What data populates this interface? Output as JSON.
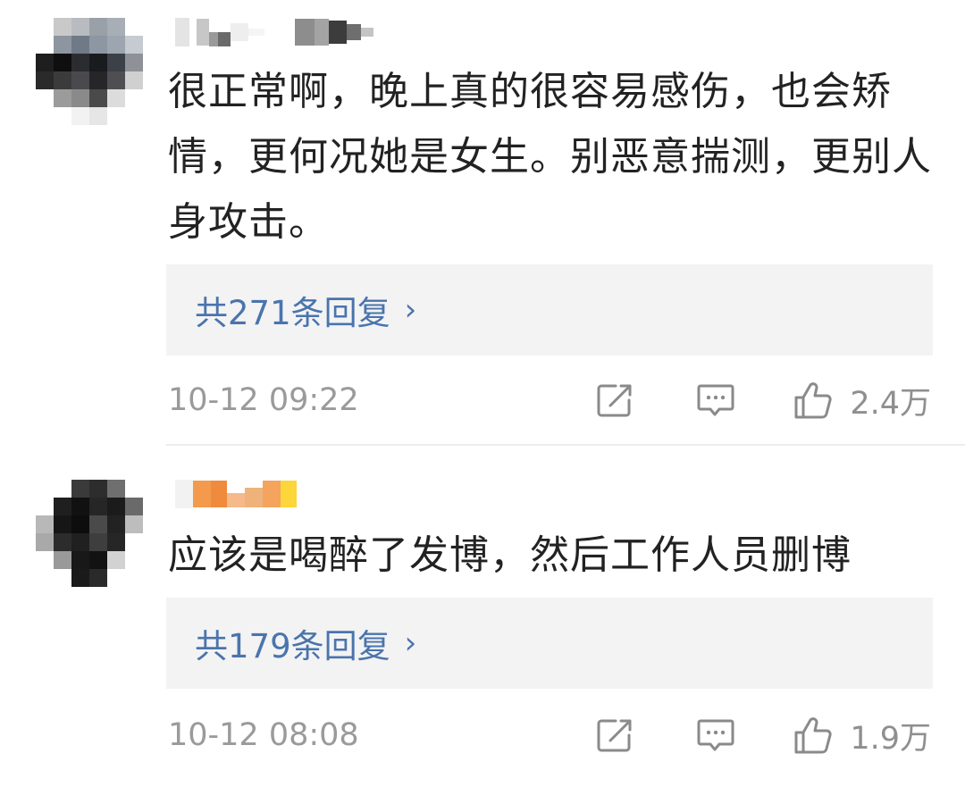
{
  "comments": [
    {
      "text": "很正常啊，晚上真的很容易感伤，也会矫情，更何况她是女生。别恶意揣测，更别人身攻击。",
      "replies_label": "共271条回复",
      "replies_chevron": "›",
      "time": "10-12 09:22",
      "likes": "2.4万"
    },
    {
      "text": "应该是喝醉了发博，然后工作人员删博",
      "replies_label": "共179条回复",
      "replies_chevron": "›",
      "time": "10-12 08:08",
      "likes": "1.9万"
    }
  ],
  "icons": {
    "share": "share-icon",
    "comment": "comment-icon",
    "like": "thumbs-up-icon"
  },
  "colors": {
    "reply_link": "#4a74ad",
    "reply_box_bg": "#f3f3f3",
    "meta_gray": "#9a9a9a"
  }
}
